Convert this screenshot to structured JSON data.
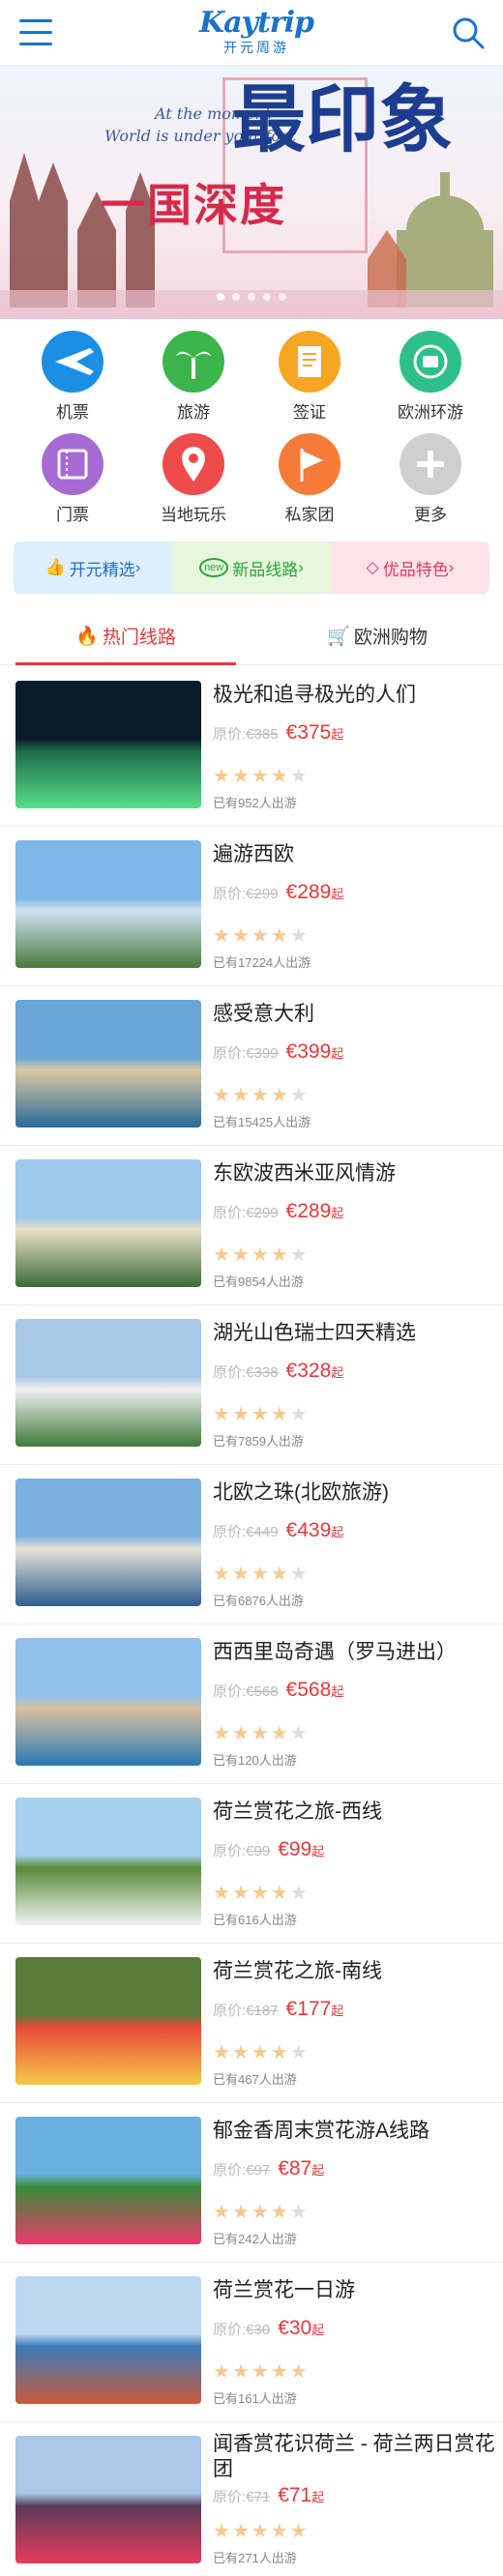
{
  "header": {
    "logo_en": "Kaytrip",
    "logo_cn": "开元周游",
    "menu_icon": "menu-icon",
    "search_icon": "search-icon"
  },
  "banner": {
    "line1": "At the moment",
    "line2": "World is under your foot",
    "cn_small": "一国深度",
    "cn_big": "最印象"
  },
  "categories": [
    {
      "label": "机票",
      "icon": "plane-icon",
      "color": "#1a8fe3"
    },
    {
      "label": "旅游",
      "icon": "palm-tree-icon",
      "color": "#3cb54a"
    },
    {
      "label": "签证",
      "icon": "document-icon",
      "color": "#f5a623"
    },
    {
      "label": "欧洲环游",
      "icon": "globe-bus-icon",
      "color": "#2ec08a"
    },
    {
      "label": "门票",
      "icon": "ticket-icon",
      "color": "#a66ad4"
    },
    {
      "label": "当地玩乐",
      "icon": "location-pin-icon",
      "color": "#ee4c4c"
    },
    {
      "label": "私家团",
      "icon": "flag-icon",
      "color": "#f57b3a"
    },
    {
      "label": "更多",
      "icon": "plus-icon",
      "color": "#cfcfcf"
    }
  ],
  "promo": [
    {
      "label": "开元精选",
      "icon": "thumbs-up-icon"
    },
    {
      "label": "新品线路",
      "icon": "new-badge-icon"
    },
    {
      "label": "优品特色",
      "icon": "diamond-icon"
    }
  ],
  "tabs": [
    {
      "label": "热门线路",
      "icon": "fire-icon"
    },
    {
      "label": "欧洲购物",
      "icon": "cart-icon"
    }
  ],
  "labels": {
    "orig_prefix": "原价:",
    "qi": "起"
  },
  "tours": [
    {
      "title": "极光和追寻极光的人们",
      "orig": "€385",
      "price": "€375",
      "sold": "已有952人出游",
      "stars": 4
    },
    {
      "title": "遍游西欧",
      "orig": "€299",
      "price": "€289",
      "sold": "已有17224人出游",
      "stars": 4
    },
    {
      "title": "感受意大利",
      "orig": "€399",
      "price": "€399",
      "sold": "已有15425人出游",
      "stars": 4
    },
    {
      "title": "东欧波西米亚风情游",
      "orig": "€299",
      "price": "€289",
      "sold": "已有9854人出游",
      "stars": 4
    },
    {
      "title": "湖光山色瑞士四天精选",
      "orig": "€338",
      "price": "€328",
      "sold": "已有7859人出游",
      "stars": 4
    },
    {
      "title": "北欧之珠(北欧旅游)",
      "orig": "€449",
      "price": "€439",
      "sold": "已有6876人出游",
      "stars": 4
    },
    {
      "title": "西西里岛奇遇（罗马进出）",
      "orig": "€568",
      "price": "€568",
      "sold": "已有120人出游",
      "stars": 4
    },
    {
      "title": "荷兰赏花之旅-西线",
      "orig": "€99",
      "price": "€99",
      "sold": "已有616人出游",
      "stars": 4
    },
    {
      "title": "荷兰赏花之旅-南线",
      "orig": "€187",
      "price": "€177",
      "sold": "已有467人出游",
      "stars": 4
    },
    {
      "title": "郁金香周末赏花游A线路",
      "orig": "€97",
      "price": "€87",
      "sold": "已有242人出游",
      "stars": 4
    },
    {
      "title": "荷兰赏花一日游",
      "orig": "€30",
      "price": "€30",
      "sold": "已有161人出游",
      "stars": 5
    },
    {
      "title": "闻香赏花识荷兰 - 荷兰两日赏花团",
      "orig": "€71",
      "price": "€71",
      "sold": "已有271人出游",
      "stars": 5
    }
  ]
}
